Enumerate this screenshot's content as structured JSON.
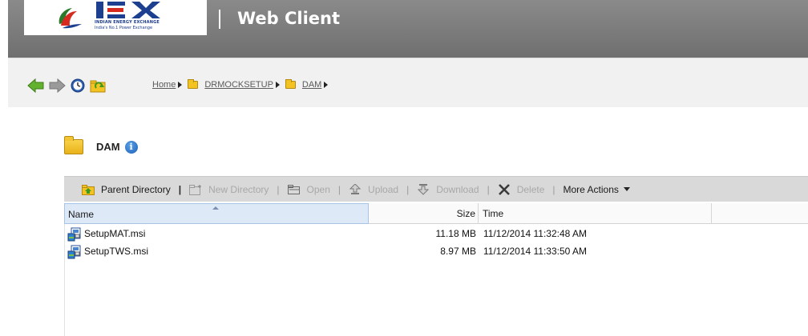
{
  "header": {
    "title": "Web Client",
    "logo_text": "IEX",
    "logo_line1": "INDIAN ENERGY EXCHANGE",
    "logo_line2": "India's No.1 Power Exchange",
    "bg_color": "#7a7a7a"
  },
  "nav": {
    "icons": [
      "back-arrow-icon",
      "forward-arrow-icon",
      "history-clock-icon",
      "refresh-folder-icon"
    ],
    "breadcrumbs": [
      {
        "label": "Home",
        "folder": false
      },
      {
        "label": "DRMOCKSETUP",
        "folder": true
      },
      {
        "label": "DAM",
        "folder": true
      }
    ]
  },
  "folder": {
    "name": "DAM",
    "info_icon": "info-icon"
  },
  "toolbar": {
    "parent_directory": "Parent Directory",
    "new_directory": "New Directory",
    "open": "Open",
    "upload": "Upload",
    "download": "Download",
    "delete": "Delete",
    "more_actions": "More Actions",
    "separator": "|"
  },
  "table": {
    "columns": {
      "name": "Name",
      "size": "Size",
      "time": "Time"
    },
    "rows": [
      {
        "name": "SetupMAT.msi",
        "size": "11.18 MB",
        "time": "11/12/2014 11:32:48 AM",
        "icon": "msi-installer-icon"
      },
      {
        "name": "SetupTWS.msi",
        "size": "8.97 MB",
        "time": "11/12/2014 11:33:50 AM",
        "icon": "msi-installer-icon"
      }
    ]
  },
  "colors": {
    "accent_green": "#5aa52a",
    "folder_yellow": "#f3c321",
    "selected_header": "#dde9f7"
  }
}
